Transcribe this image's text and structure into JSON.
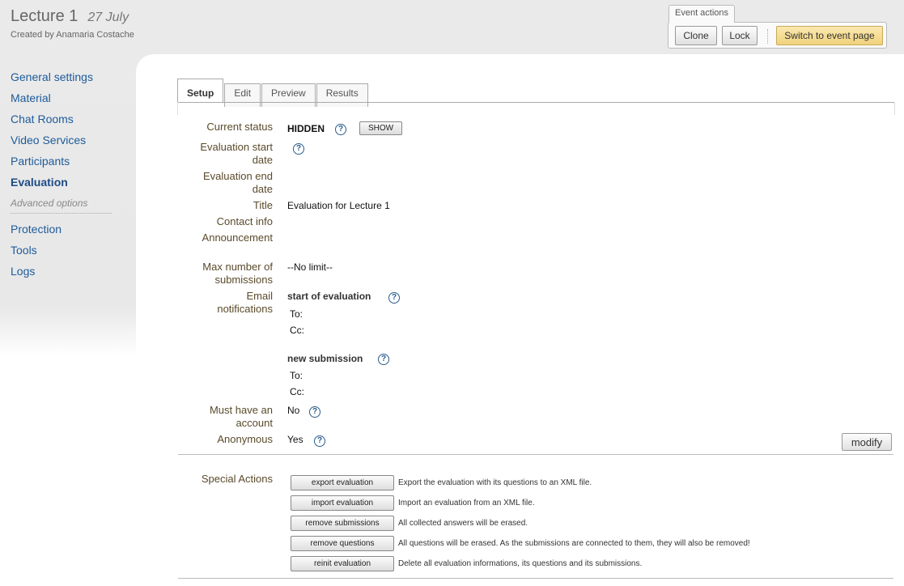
{
  "header": {
    "title": "Lecture 1",
    "date": "27 July",
    "subtitle": "Created by Anamaria Costache"
  },
  "event_actions": {
    "label": "Event actions",
    "clone": "Clone",
    "lock": "Lock",
    "switch": "Switch to event page"
  },
  "sidebar": {
    "items": [
      {
        "label": "General settings"
      },
      {
        "label": "Material"
      },
      {
        "label": "Chat Rooms"
      },
      {
        "label": "Video Services"
      },
      {
        "label": "Participants"
      },
      {
        "label": "Evaluation"
      }
    ],
    "advanced_heading": "Advanced options",
    "advanced_items": [
      {
        "label": "Protection"
      },
      {
        "label": "Tools"
      },
      {
        "label": "Logs"
      }
    ]
  },
  "tabs": [
    {
      "label": "Setup"
    },
    {
      "label": "Edit"
    },
    {
      "label": "Preview"
    },
    {
      "label": "Results"
    }
  ],
  "form": {
    "current_status_label": "Current status",
    "current_status_value": "HIDDEN",
    "show_button": "SHOW",
    "eval_start_label_1": "Evaluation start",
    "eval_start_label_2": "date",
    "eval_end_label_1": "Evaluation end",
    "eval_end_label_2": "date",
    "title_label": "Title",
    "title_value": "Evaluation for Lecture 1",
    "contact_label": "Contact info",
    "announcement_label": "Announcement",
    "max_sub_label_1": "Max number of",
    "max_sub_label_2": "submissions",
    "max_sub_value": "--No limit--",
    "email_label_1": "Email",
    "email_label_2": "notifications",
    "start_eval_heading": "start of evaluation",
    "to_label": "To:",
    "cc_label": "Cc:",
    "new_sub_heading": "new submission",
    "account_label_1": "Must have an",
    "account_label_2": "account",
    "account_value": "No",
    "anonymous_label": "Anonymous",
    "anonymous_value": "Yes",
    "modify_button": "modify"
  },
  "special_actions": {
    "label": "Special Actions",
    "actions": [
      {
        "button": "export evaluation",
        "desc": "Export the evaluation with its questions to an XML file."
      },
      {
        "button": "import evaluation",
        "desc": "Import an evaluation from an XML file."
      },
      {
        "button": "remove submissions",
        "desc": "All collected answers will be erased."
      },
      {
        "button": "remove questions",
        "desc": "All questions will be erased. As the submissions are connected to them, they will also be removed!"
      },
      {
        "button": "reinit evaluation",
        "desc": "Delete all evaluation informations, its questions and its submissions."
      }
    ]
  }
}
